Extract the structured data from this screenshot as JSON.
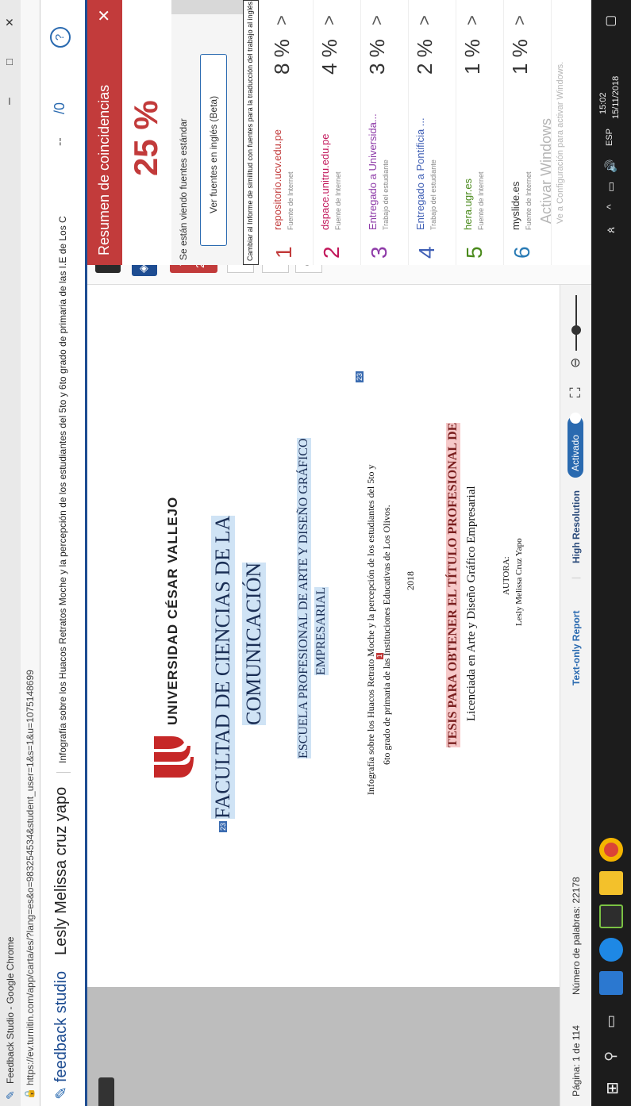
{
  "window": {
    "title": "Feedback Studio - Google Chrome",
    "minimize": "–",
    "maximize": "□",
    "close": "✕"
  },
  "browser": {
    "url": "https://ev.turnitin.com/app/carta/es/?lang=es&o=983254534&student_user=1&s=1&u=1075148699"
  },
  "header": {
    "brand": "feedback studio",
    "student": "Lesly Melissa cruz yapo",
    "doc_title": "Infografía sobre los Huacos Retratos Moche y la percepción de los estudiantes del 5to y 6to grado de primaria de las I.E de Los C",
    "score_slash": "/0",
    "help": "?"
  },
  "document": {
    "university": "UNIVERSIDAD CÉSAR VALLEJO",
    "faculty_line1": "FACULTAD DE CIENCIAS DE LA",
    "faculty_line2": "COMUNICACIÓN",
    "school_line1": "ESCUELA PROFESIONAL DE ARTE Y DISEÑO GRÁFICO",
    "school_line2": "EMPRESARIAL",
    "topic_line1": "Infografía sobre los Huacos Retrato Moche y la percepción de los estudiantes del 5to y",
    "topic_line2": "6to grado de primaria de las Instituciones Educativas de Los Olivos.",
    "year": "2018",
    "thesis_line1": "TESIS PARA OBTENER EL TÍTULO PROFESIONAL DE",
    "thesis_line2": "Licenciada en Arte y Diseño Gráfico Empresarial",
    "author_label": "AUTORA:",
    "author_name": "Lesly Melissa Cruz Yapo",
    "marker_a": "23",
    "marker_b": "23",
    "marker_c": "1"
  },
  "footer": {
    "page": "Página: 1 de 114",
    "words": "Número de palabras: 22178",
    "text_only": "Text-only Report",
    "high_res": "High Resolution",
    "toggle": "Activado"
  },
  "tools": {
    "score": "25"
  },
  "panel": {
    "title": "Resumen de coincidencias",
    "close": "✕",
    "percent": "25 %",
    "standard_sources": "Se están viendo fuentes estándar",
    "english_btn": "Ver fuentes en inglés (Beta)",
    "tooltip": "Cambiar al Informe de similitud con fuentes para la traducción del trabajo al inglés",
    "matches": [
      {
        "num": "1",
        "source": "repositorio.ucv.edu.pe",
        "type": "Fuente de Internet",
        "pct": "8 %",
        "color": "#c23b3b"
      },
      {
        "num": "2",
        "source": "dspace.unitru.edu.pe",
        "type": "Fuente de Internet",
        "pct": "4 %",
        "color": "#c2185b"
      },
      {
        "num": "3",
        "source": "Entregado a Universida...",
        "type": "Trabajo del estudiante",
        "pct": "3 %",
        "color": "#8e3ba8"
      },
      {
        "num": "4",
        "source": "Entregado a Pontificia ...",
        "type": "Trabajo del estudiante",
        "pct": "2 %",
        "color": "#3f5fb5"
      },
      {
        "num": "5",
        "source": "hera.ugr.es",
        "type": "Fuente de Internet",
        "pct": "1 %",
        "color": "#4a8a1c"
      },
      {
        "num": "6",
        "source": "myslide.es",
        "type": "Fuente de Internet",
        "pct": "1 %",
        "color": "#2a7bb5"
      }
    ],
    "arrow": ">"
  },
  "watermark": {
    "line1": "Activar Windows",
    "line2": "Ve a Configuración para activar Windows."
  },
  "taskbar": {
    "lang": "ESP",
    "time": "15:02",
    "date": "15/11/2018"
  },
  "colors": {
    "accent_red": "#c23b3b",
    "header_blue": "#1e4d92",
    "link_blue": "#2a6ab0"
  }
}
